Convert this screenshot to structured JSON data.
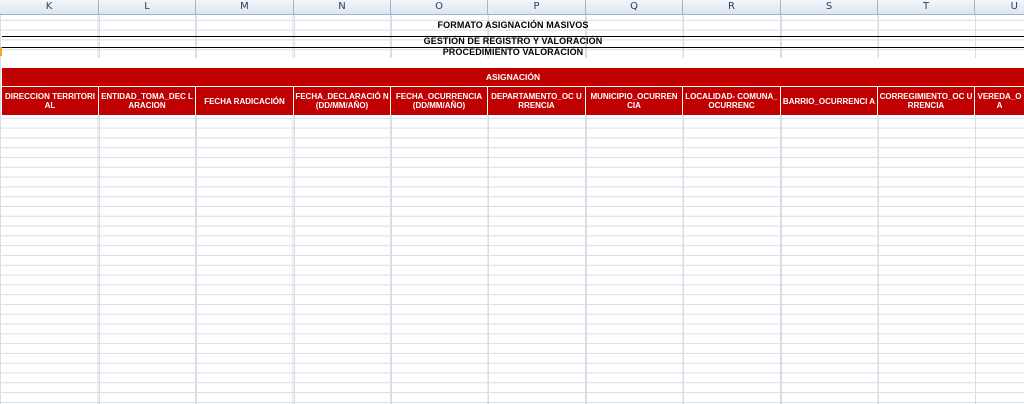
{
  "columns": [
    "K",
    "L",
    "M",
    "N",
    "O",
    "P",
    "Q",
    "R",
    "S",
    "T",
    "U"
  ],
  "titles": {
    "main": "FORMATO ASIGNACIÓN MASIVOS",
    "sub1": "GESTIÓN DE REGISTRO Y VALORACIÓN",
    "sub2": "PROCEDIMIENTO VALORACIÓN"
  },
  "banner": "ASIGNACIÓN",
  "headers": [
    "DIRECCION TERRITORIAL",
    "ENTIDAD_TOMA_DEC LARACION",
    "FECHA RADICACIÓN",
    "FECHA_DECLARACIÓ N(DD/MM/AÑO)",
    "FECHA_OCURRENCIA (DD/MM/AÑO)",
    "DEPARTAMENTO_OC URRENCIA",
    "MUNICIPIO_OCURREN CIA",
    "LOCALIDAD- COMUNA_OCURRENC",
    "BARRIO_OCURRENCI A",
    "CORREGIMIENTO_OC URRENCIA",
    "VEREDA_O A"
  ],
  "colors": {
    "header_red": "#c00000",
    "grid": "#d8dde6",
    "column_header_bg": "#dde5ef"
  }
}
